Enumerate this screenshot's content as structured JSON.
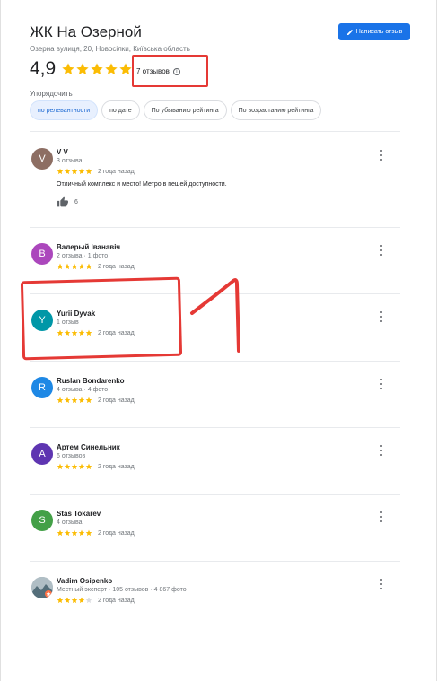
{
  "header": {
    "title": "ЖК На Озерной",
    "address": "Озерна вулиця, 20, Новосілки, Київська область",
    "write_review": "Написать отзыв"
  },
  "summary": {
    "rating": "4,9",
    "rating_value": 4.9,
    "count_label": "7 отзывов"
  },
  "sort": {
    "label": "Упорядочить",
    "options": [
      "по релевантности",
      "по дате",
      "По убыванию рейтинга",
      "По возрастанию рейтинга"
    ],
    "selected": "по релевантности"
  },
  "reviews": [
    {
      "name": "V V",
      "initial": "V",
      "color": "#8d6e63",
      "meta": "3 отзыва",
      "stars": 5,
      "date": "2 года назад",
      "text": "Отличный комплекс и место! Метро в пешей доступности.",
      "likes": "6"
    },
    {
      "name": "Валерый Іванавіч",
      "initial": "В",
      "color": "#ab47bc",
      "meta": "2 отзыва · 1 фото",
      "stars": 5,
      "date": "2 года назад"
    },
    {
      "name": "Yurii Dyvak",
      "initial": "Y",
      "color": "#0097a7",
      "meta": "1 отзыв",
      "stars": 5,
      "date": "2 года назад"
    },
    {
      "name": "Ruslan Bondarenko",
      "initial": "R",
      "color": "#1e88e5",
      "meta": "4 отзыва · 4 фото",
      "stars": 5,
      "date": "2 года назад"
    },
    {
      "name": "Артем Синельник",
      "initial": "A",
      "color": "#5e35b1",
      "meta": "6 отзывов",
      "stars": 5,
      "date": "2 года назад"
    },
    {
      "name": "Stas Tokarev",
      "initial": "S",
      "color": "#43a047",
      "meta": "4 отзыва",
      "stars": 5,
      "date": "2 года назад"
    },
    {
      "name": "Vadim Osipenko",
      "initial": "",
      "color": "#78909c",
      "meta": "Местный эксперт · 105 отзывов · 4 867 фото",
      "stars": 4,
      "date": "2 года назад"
    }
  ],
  "colors": {
    "accent": "#1a73e8",
    "star": "#fbbc04",
    "annotation": "#e53935"
  }
}
